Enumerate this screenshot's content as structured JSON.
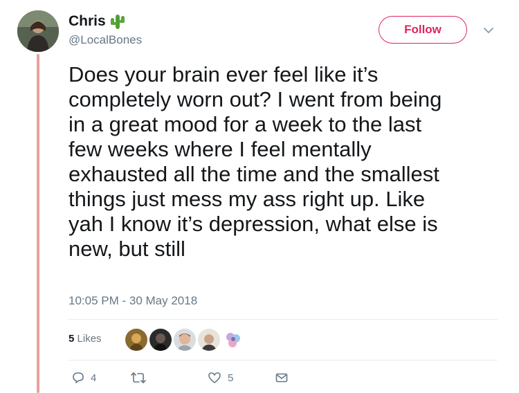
{
  "user": {
    "display_name": "Chris",
    "handle": "@LocalBones",
    "name_emoji": "cactus-icon"
  },
  "header": {
    "follow_label": "Follow",
    "menu_icon": "chevron-down-icon"
  },
  "tweet": {
    "text": "Does your brain ever feel like it’s\ncompletely worn out? I went from being\nin a great mood for a week to the last\nfew weeks where I feel mentally\nexhausted all the time and the smallest\nthings just mess my ass right up. Like\nyah I know it’s depression, what else is\nnew, but still",
    "timestamp": "10:05 PM - 30 May 2018"
  },
  "stats": {
    "likes_count": "5",
    "likes_label": "Likes",
    "liker_avatars": 5
  },
  "actions": {
    "reply_count": "4",
    "retweet_count": "",
    "like_count": "5"
  },
  "colors": {
    "accent": "#e0245e",
    "thread_line": "#e8a09b",
    "muted_text": "#657786",
    "divider": "#e6ecf0"
  }
}
